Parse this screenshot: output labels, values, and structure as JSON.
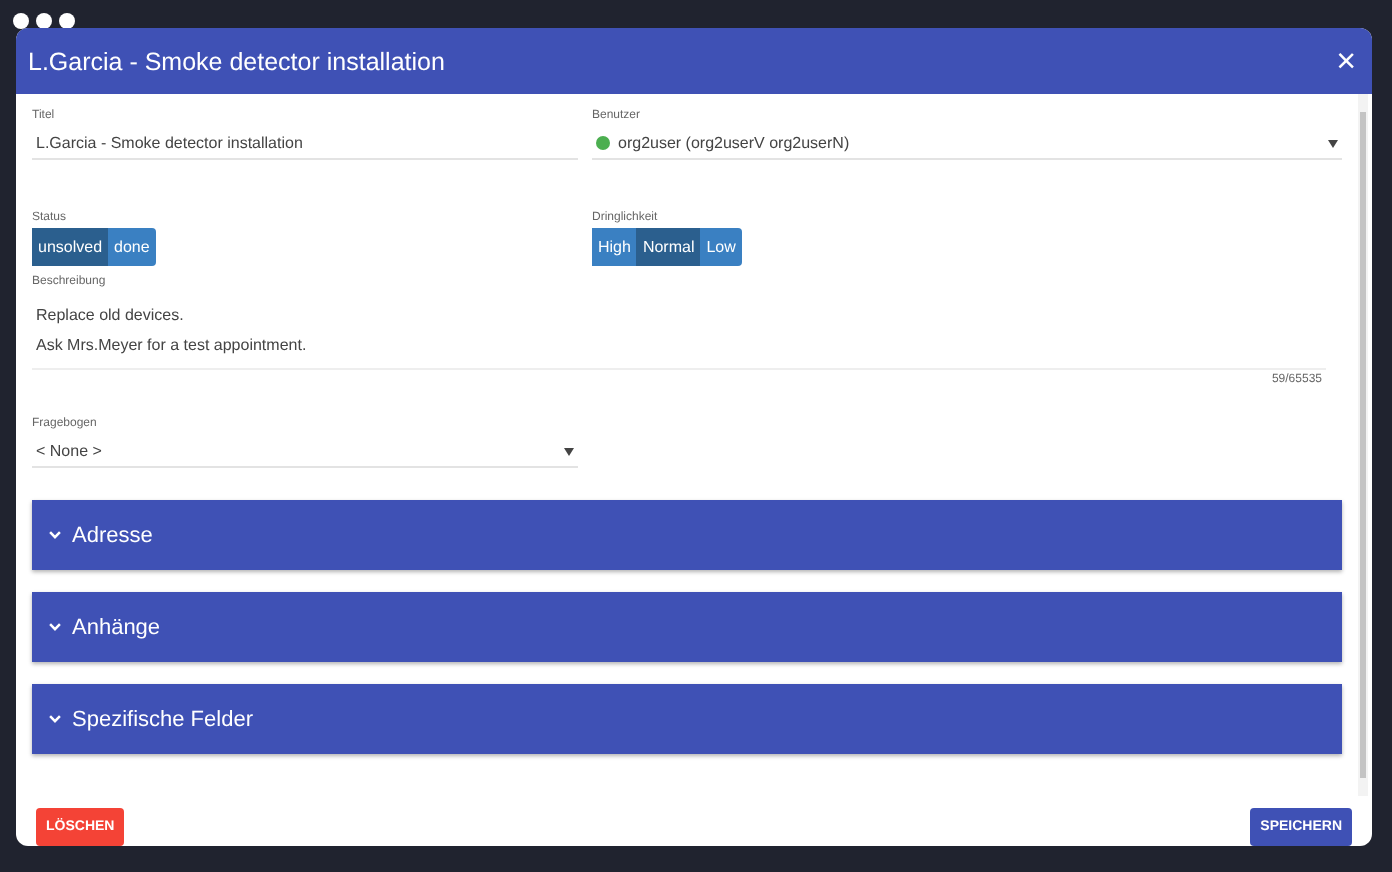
{
  "window": {
    "title": "L.Garcia - Smoke detector installation",
    "close": "×"
  },
  "fields": {
    "title": {
      "label": "Titel",
      "value": "L.Garcia - Smoke detector installation"
    },
    "user": {
      "label": "Benutzer",
      "value": "org2user (org2userV org2userN)",
      "color": "#4caf50"
    },
    "status": {
      "label": "Status",
      "options": [
        {
          "label": "unsolved",
          "selected": true
        },
        {
          "label": "done",
          "selected": false
        }
      ]
    },
    "urgency": {
      "label": "Dringlichkeit",
      "options": [
        {
          "label": "High",
          "selected": false
        },
        {
          "label": "Normal",
          "selected": true
        },
        {
          "label": "Low",
          "selected": false
        }
      ]
    },
    "description": {
      "label": "Beschreibung",
      "value": "Replace old devices.\nAsk Mrs.Meyer for a test appointment.",
      "counter": "59/65535"
    },
    "questionnaire": {
      "label": "Fragebogen",
      "value": "< None >"
    }
  },
  "sections": [
    {
      "title": "Adresse",
      "expanded": false
    },
    {
      "title": "Anhänge",
      "expanded": false
    },
    {
      "title": "Spezifische Felder",
      "expanded": false
    }
  ],
  "buttons": [
    {
      "label": "LÖSCHEN",
      "kind": "danger"
    },
    {
      "label": "SPEICHERN",
      "kind": "primary"
    }
  ]
}
